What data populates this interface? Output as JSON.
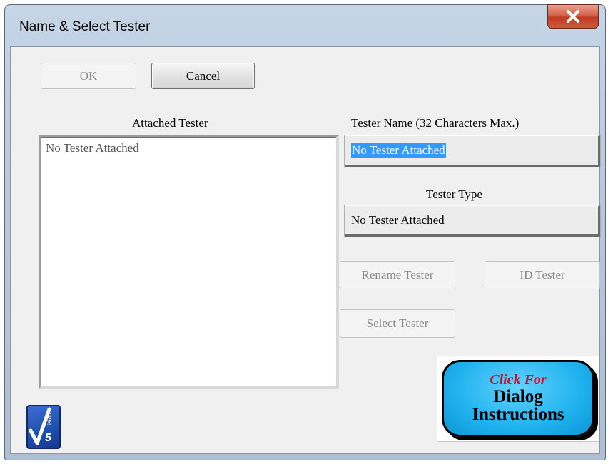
{
  "window": {
    "title": "Name & Select Tester"
  },
  "buttons": {
    "ok": "OK",
    "cancel": "Cancel",
    "rename": "Rename Tester",
    "id": "ID Tester",
    "select": "Select Tester"
  },
  "attached": {
    "heading": "Attached Tester",
    "items": [
      "No Tester Attached"
    ]
  },
  "tester_name": {
    "label": "Tester Name (32 Characters Max.)",
    "value": "No Tester Attached"
  },
  "tester_type": {
    "label": "Tester Type",
    "value": "No Tester Attached"
  },
  "help": {
    "line1": "Click For",
    "line2": "Dialog",
    "line3": "Instructions"
  },
  "logo": {
    "text": "ision",
    "number": "5"
  },
  "colors": {
    "selection": "#3399ff",
    "help_bg": "#1fb2ee",
    "help_accent": "#c8102e",
    "close_button": "#c7472c"
  }
}
